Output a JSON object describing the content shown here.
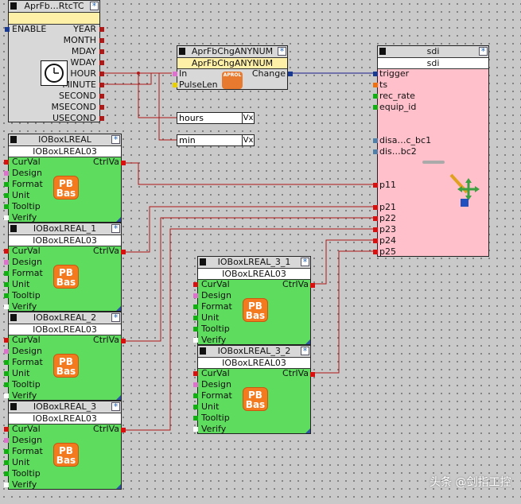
{
  "colors": {
    "wire": "#b01818",
    "wire_blue": "#1a1a8c",
    "io_green": "#5ddc5d",
    "sdi_pink": "#ffc0cb",
    "label_yellow": "#fff0a8",
    "pin_red": "#d81010",
    "pin_blue": "#1a3a90",
    "pin_pink": "#e070d0",
    "pin_green": "#10b010",
    "pin_white": "#ffffff",
    "pin_black": "#000000",
    "pin_yellow": "#e8d000",
    "pin_orange": "#f07010",
    "pin_steel": "#5080a8"
  },
  "rtc": {
    "title": "AprFb…RtcTC",
    "star": "*",
    "input": "ENABLE",
    "outputs": [
      "YEAR",
      "MONTH",
      "MDAY",
      "WDAY",
      "HOUR",
      "MINUTE",
      "SECOND",
      "MSECOND",
      "USECOND"
    ],
    "clock_icon": "clock-icon"
  },
  "chg": {
    "title": "AprFbChgANYNUM",
    "type": "AprFbChgANYNUM",
    "star": "*",
    "inputs": [
      "In",
      "PulseLen"
    ],
    "output": "Change",
    "logo": "APROL"
  },
  "fields": [
    {
      "text": "hours",
      "suffix": "Vx"
    },
    {
      "text": "min",
      "suffix": "Vx"
    }
  ],
  "sdi": {
    "title": "sdi",
    "type": "sdi",
    "star": "*",
    "inputs": [
      "trigger",
      "ts",
      "rec_rate",
      "equip_id"
    ],
    "inputs2": [
      "disa…c_bc1",
      "dis…bc2"
    ],
    "ports": [
      "p11",
      "p21",
      "p22",
      "p23",
      "p24",
      "p25"
    ]
  },
  "io_blocks": [
    {
      "title": "IOBoxLREAL",
      "type": "IOBoxLREAL03"
    },
    {
      "title": "IOBoxLREAL_1",
      "type": "IOBoxLREAL03"
    },
    {
      "title": "IOBoxLREAL_2",
      "type": "IOBoxLREAL03"
    },
    {
      "title": "IOBoxLREAL_3",
      "type": "IOBoxLREAL03"
    },
    {
      "title": "IOBoxLREAL_3_1",
      "type": "IOBoxLREAL03"
    },
    {
      "title": "IOBoxLREAL_3_2",
      "type": "IOBoxLREAL03"
    }
  ],
  "io_inputs": [
    "CurVal",
    "Design",
    "Format",
    "Unit",
    "Tooltip",
    "Verify"
  ],
  "io_output": "CtrlVa",
  "io_logo": [
    "PB",
    "Bas"
  ],
  "star": "*",
  "watermark": "头条 @剑指工控"
}
